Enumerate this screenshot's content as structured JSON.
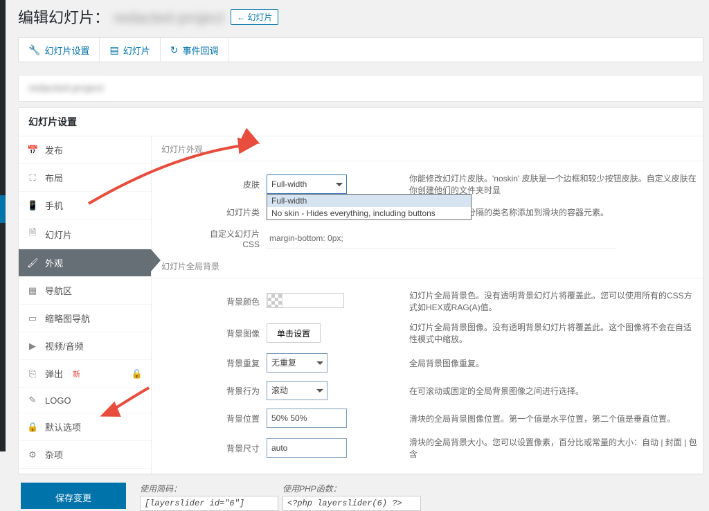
{
  "page_title_prefix": "编辑幻灯片：",
  "page_title_name": "redacted-project",
  "header_link": "← 幻灯片",
  "tabs": [
    {
      "label": "幻灯片设置",
      "icon": "wrench-icon"
    },
    {
      "label": "幻灯片",
      "icon": "layers-icon"
    },
    {
      "label": "事件回调",
      "icon": "redo-icon"
    }
  ],
  "slider_name": "redacted-project",
  "panel_title": "幻灯片设置",
  "side_nav": [
    {
      "label": "发布",
      "icon": "calendar-icon"
    },
    {
      "label": "布局",
      "icon": "expand-icon"
    },
    {
      "label": "手机",
      "icon": "mobile-icon"
    },
    {
      "label": "幻灯片",
      "icon": "file-icon"
    },
    {
      "label": "外观",
      "icon": "brush-icon",
      "active": true
    },
    {
      "label": "导航区",
      "icon": "nav-icon"
    },
    {
      "label": "缩略图导航",
      "icon": "thumb-icon"
    },
    {
      "label": "视频/音频",
      "icon": "play-icon"
    },
    {
      "label": "弹出",
      "icon": "popup-icon",
      "badge": "新",
      "locked": true
    },
    {
      "label": "LOGO",
      "icon": "pen-icon"
    },
    {
      "label": "默认选项",
      "icon": "lock-icon"
    },
    {
      "label": "杂项",
      "icon": "gear-icon"
    }
  ],
  "section_appearance": "幻灯片外观",
  "row_skin": {
    "label": "皮肤",
    "value": "Full-width",
    "desc": "你能修改幻灯片皮肤。'noskin' 皮肤是一个边框和较少按钮皮肤。自定义皮肤在你创建他们的文件夹时显"
  },
  "dropdown_options": [
    "Full-width",
    "No skin - Hides everything, including buttons"
  ],
  "row_class": {
    "label": "幻灯片类",
    "desc": "一个或多个空格分隔的类名称添加到滑块的容器元素。"
  },
  "row_css": {
    "label": "自定义幻灯片CSS",
    "value": "margin-bottom: 0px;"
  },
  "section_bg": "幻灯片全局背景",
  "row_bgcolor": {
    "label": "背景颜色",
    "desc": "幻灯片全局背景色。没有透明背景幻灯片将覆盖此。您可以使用所有的CSS方式如HEX或RAG(A)值。"
  },
  "row_bgimage": {
    "label": "背景图像",
    "button": "单击设置",
    "desc": "幻灯片全局背景图像。没有透明背景幻灯片将覆盖此。这个图像将不会在自适性模式中缩放。"
  },
  "row_repeat": {
    "label": "背景重复",
    "value": "无重复",
    "desc": "全局背景图像重复。"
  },
  "row_behavior": {
    "label": "背景行为",
    "value": "滚动",
    "desc": "在可滚动或固定的全局背景图像之间进行选择。"
  },
  "row_position": {
    "label": "背景位置",
    "value": "50% 50%",
    "desc": "滑块的全局背景图像位置。第一个值是水平位置，第二个值是垂直位置。"
  },
  "row_size": {
    "label": "背景尺寸",
    "value": "auto",
    "desc": "滑块的全局背景大小。您可以设置像素，百分比或常量的大小：自动 | 封面 | 包含"
  },
  "save_button": "保存变更",
  "shortcode_label": "使用简码：",
  "shortcode_value": "[layerslider id=\"6\"]",
  "phpfunc_label": "使用PHP函数：",
  "phpfunc_value": "<?php layerslider(6) ?>"
}
